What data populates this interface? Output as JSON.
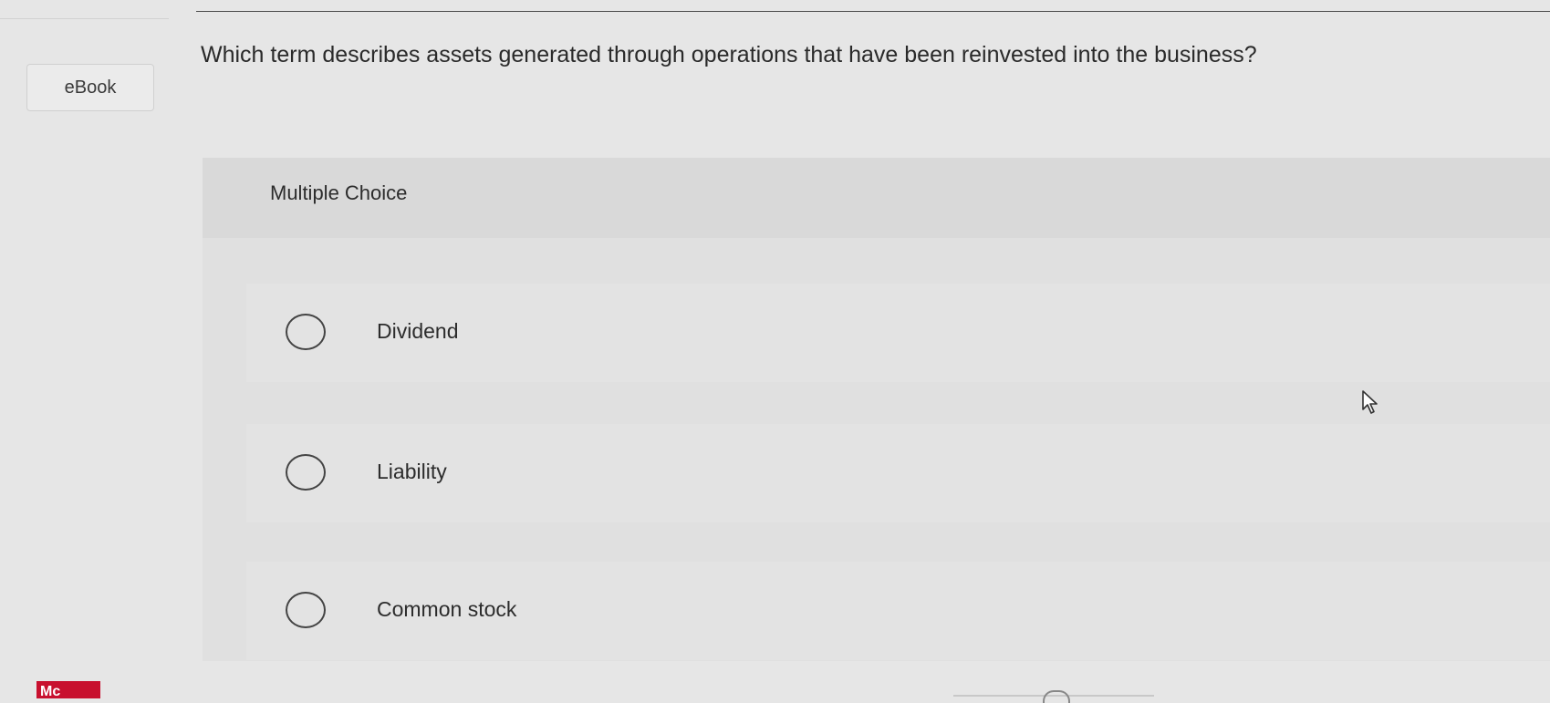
{
  "ebook": {
    "label": "eBook"
  },
  "question": {
    "text": "Which term describes assets generated through operations that have been reinvested into the business?"
  },
  "multiple_choice": {
    "title": "Multiple Choice",
    "options": [
      {
        "label": "Dividend",
        "selected": false
      },
      {
        "label": "Liability",
        "selected": false
      },
      {
        "label": "Common stock",
        "selected": false
      }
    ]
  },
  "logo": {
    "text": "Mc",
    "color": "#c8102e"
  },
  "icons": {
    "cursor": "mouse-pointer-icon",
    "radio": "radio-unchecked-icon"
  }
}
